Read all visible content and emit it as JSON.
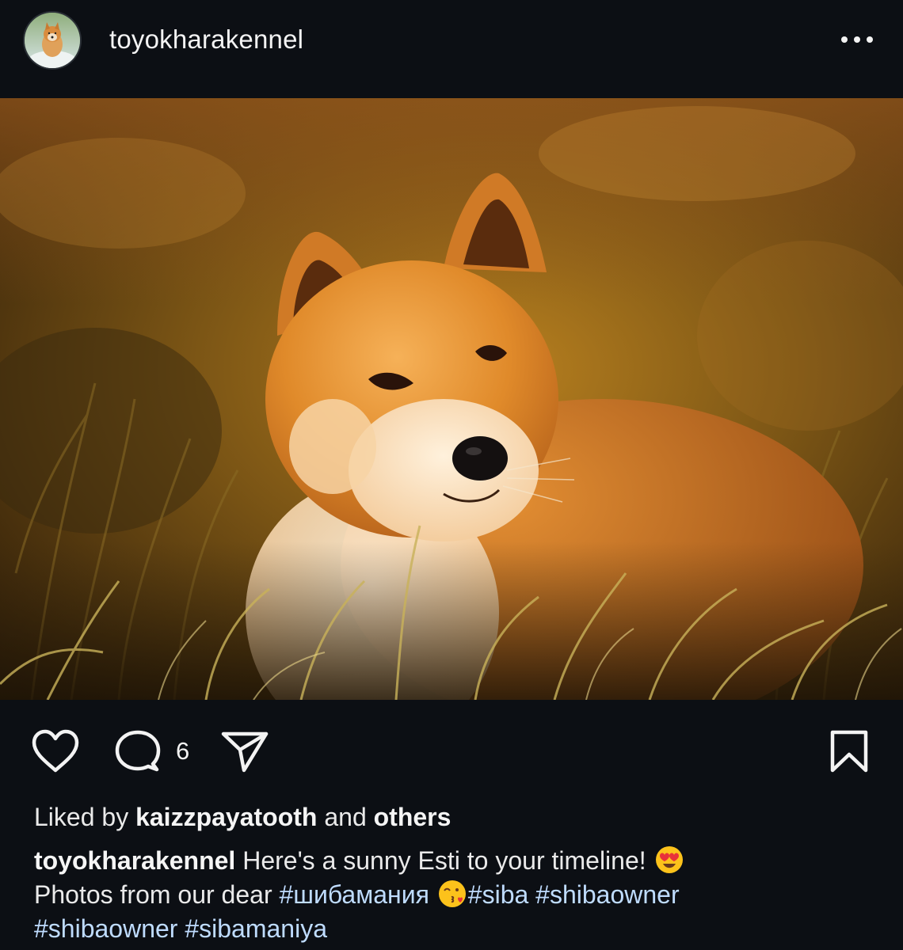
{
  "post": {
    "username": "toyokharakennel",
    "more_icon": "more-horizontal-icon",
    "photo_alt": "Shiba Inu lying in golden grass at sunset"
  },
  "actions": {
    "like_icon": "heart-icon",
    "comment_icon": "comment-icon",
    "comment_count": "6",
    "share_icon": "send-icon",
    "save_icon": "bookmark-icon"
  },
  "likes": {
    "prefix": "Liked by",
    "user": "kaizzpayatooth",
    "conjunction": "and",
    "others": "others"
  },
  "caption": {
    "author": "toyokharakennel",
    "text_1": "Here's a sunny Esti to your timeline!",
    "emoji_1": "heart-eyes-emoji",
    "text_2": "Photos from our dear",
    "tag_1": "#шибамания",
    "emoji_2": "kiss-emoji",
    "tag_2": "#siba",
    "tag_3": "#shibaowner",
    "tag_4": "#shibaowner",
    "tag_5": "#sibamaniya"
  },
  "colors": {
    "background": "#0c0f14",
    "text": "#f5f5f5",
    "hashtag": "#bfdcff"
  }
}
